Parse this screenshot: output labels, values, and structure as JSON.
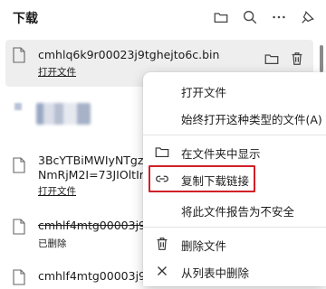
{
  "header": {
    "title": "下载",
    "icons": [
      "folder-icon",
      "search-icon",
      "more-icon",
      "pin-icon"
    ]
  },
  "items": [
    {
      "name": "cmhlq6k9r00023j9tghejto6c.bin",
      "status": "打开文件",
      "status_link": true,
      "deleted": false
    },
    {
      "name": "",
      "status": "",
      "status_link": false,
      "deleted": false
    },
    {
      "name_line1": "3BcYTBiMWIyNTgzM",
      "name_line2": "NmRjM2I=73JIOltIm",
      "status": "打开文件",
      "status_link": true,
      "deleted": false
    },
    {
      "name": "cmhlf4mtg00003j9tn",
      "status": "已删除",
      "status_link": false,
      "deleted": true
    },
    {
      "name": "cmhlf4mtg00003j9tn",
      "status": "",
      "status_link": false,
      "deleted": false
    }
  ],
  "context_menu": {
    "items": [
      {
        "label": "打开文件",
        "icon": ""
      },
      {
        "label": "始终打开这种类型的文件(A)",
        "icon": ""
      },
      {
        "label": "在文件夹中显示",
        "icon": "folder-icon"
      },
      {
        "label": "复制下载链接",
        "icon": "link-icon"
      },
      {
        "label": "将此文件报告为不安全",
        "icon": ""
      },
      {
        "label": "删除文件",
        "icon": "trash-icon"
      },
      {
        "label": "从列表中删除",
        "icon": "close-icon"
      }
    ],
    "highlighted_item": "复制下载链接",
    "highlight_color": "#d21f26"
  }
}
